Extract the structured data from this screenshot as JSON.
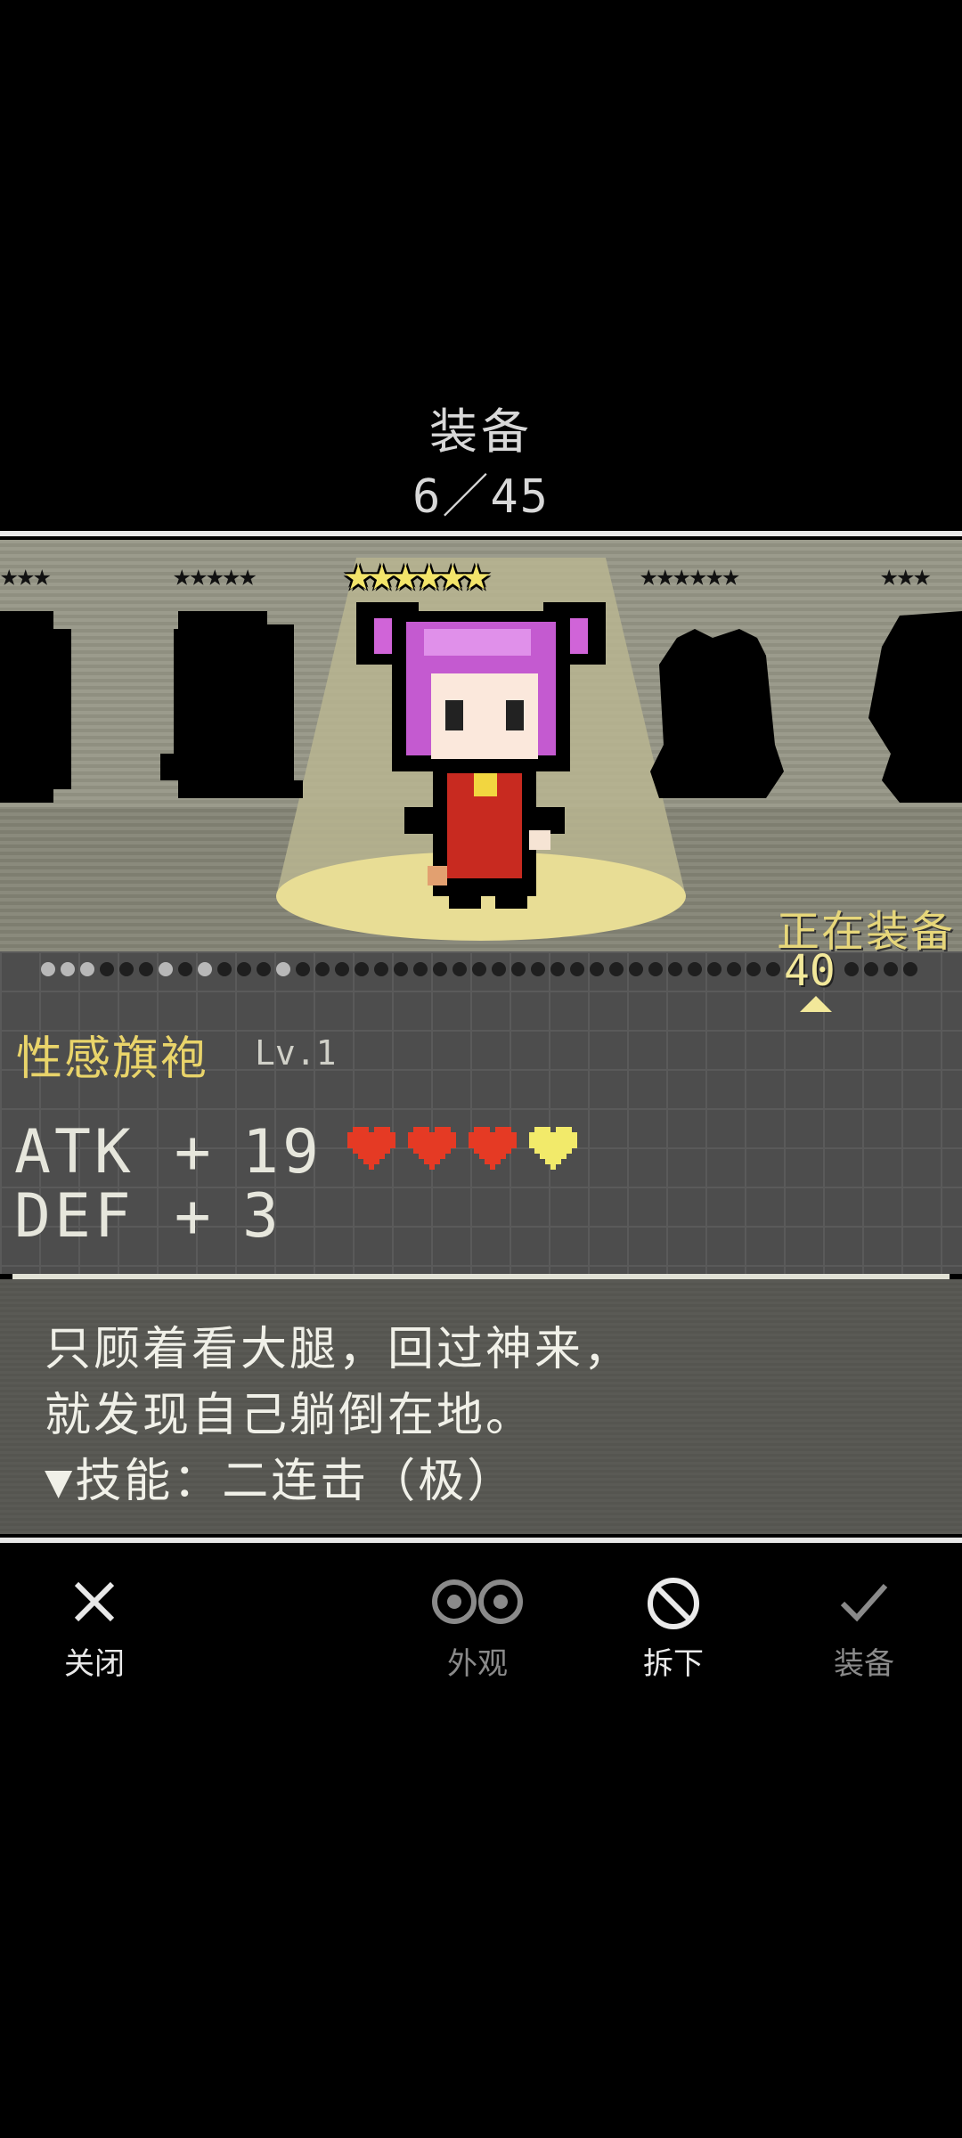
{
  "header": {
    "title": "装备",
    "count": "6／45"
  },
  "stage": {
    "star_groups": [
      "★★★",
      "★★★★★",
      "★★★★★★",
      "★★★★★★",
      "★★★"
    ],
    "status": "正在装备"
  },
  "selector": {
    "current": "40"
  },
  "item": {
    "name": "性感旗袍",
    "level": "Lv.1",
    "atk_label": "ATK +",
    "atk_value": "19",
    "def_label": "DEF +",
    "def_value": "3",
    "hearts": 4,
    "heart_colors": [
      "#e53a24",
      "#e53a24",
      "#e53a24",
      "#f2ea6a"
    ]
  },
  "description": {
    "line1": "只顾着看大腿，回过神来，",
    "line2": "就发现自己躺倒在地。",
    "line3": "▼技能：二连击（极）"
  },
  "buttons": {
    "close": "关闭",
    "appearance": "外观",
    "unequip": "拆下",
    "equip": "装备"
  },
  "icons": {
    "close": "close-x-icon",
    "appearance": "eyes-icon",
    "unequip": "prohibit-icon",
    "equip": "checkmark-icon"
  }
}
